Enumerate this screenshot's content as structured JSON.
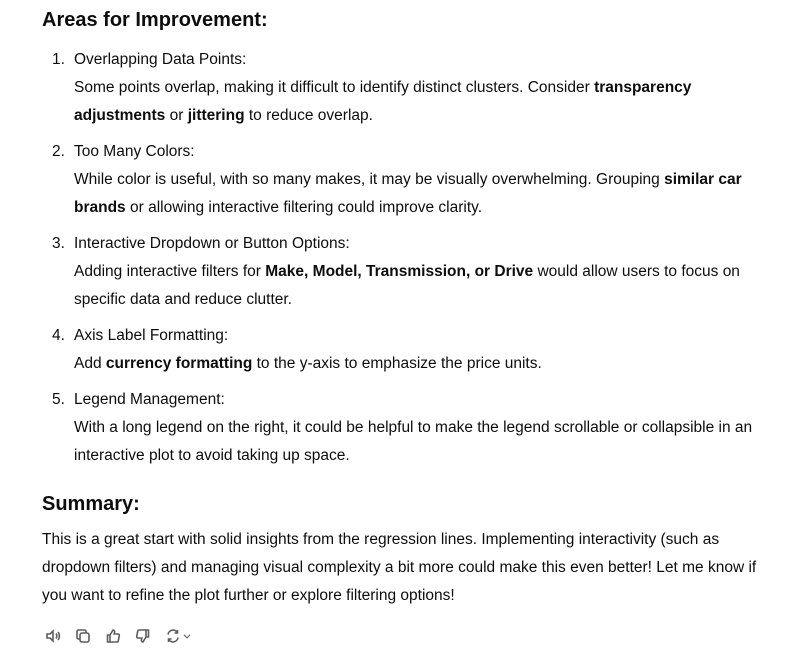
{
  "areas_heading": "Areas for Improvement:",
  "items": [
    {
      "num": "1.",
      "title": "Overlapping Data Points:",
      "desc": [
        {
          "t": "Some points overlap, making it difficult to identify distinct clusters. Consider ",
          "b": false
        },
        {
          "t": "transparency adjustments",
          "b": true
        },
        {
          "t": " or ",
          "b": false
        },
        {
          "t": "jittering",
          "b": true
        },
        {
          "t": " to reduce overlap.",
          "b": false
        }
      ]
    },
    {
      "num": "2.",
      "title": "Too Many Colors:",
      "desc": [
        {
          "t": "While color is useful, with so many makes, it may be visually overwhelming. Grouping ",
          "b": false
        },
        {
          "t": "similar car brands",
          "b": true
        },
        {
          "t": " or allowing interactive filtering could improve clarity.",
          "b": false
        }
      ]
    },
    {
      "num": "3.",
      "title": "Interactive Dropdown or Button Options:",
      "desc": [
        {
          "t": "Adding interactive filters for ",
          "b": false
        },
        {
          "t": "Make, Model, Transmission, or Drive",
          "b": true
        },
        {
          "t": " would allow users to focus on specific data and reduce clutter.",
          "b": false
        }
      ]
    },
    {
      "num": "4.",
      "title": "Axis Label Formatting:",
      "desc": [
        {
          "t": "Add ",
          "b": false
        },
        {
          "t": "currency formatting",
          "b": true
        },
        {
          "t": " to the y-axis to emphasize the price units.",
          "b": false
        }
      ]
    },
    {
      "num": "5.",
      "title": "Legend Management:",
      "desc": [
        {
          "t": "With a long legend on the right, it could be helpful to make the legend scrollable or collapsible in an interactive plot to avoid taking up space.",
          "b": false
        }
      ]
    }
  ],
  "summary_heading": "Summary:",
  "summary_text": "This is a great start with solid insights from the regression lines. Implementing interactivity (such as dropdown filters) and managing visual complexity a bit more could make this even better! Let me know if you want to refine the plot further or explore filtering options!",
  "actions": [
    "read-aloud-icon",
    "copy-icon",
    "thumbs-up-icon",
    "thumbs-down-icon",
    "regenerate-icon"
  ]
}
